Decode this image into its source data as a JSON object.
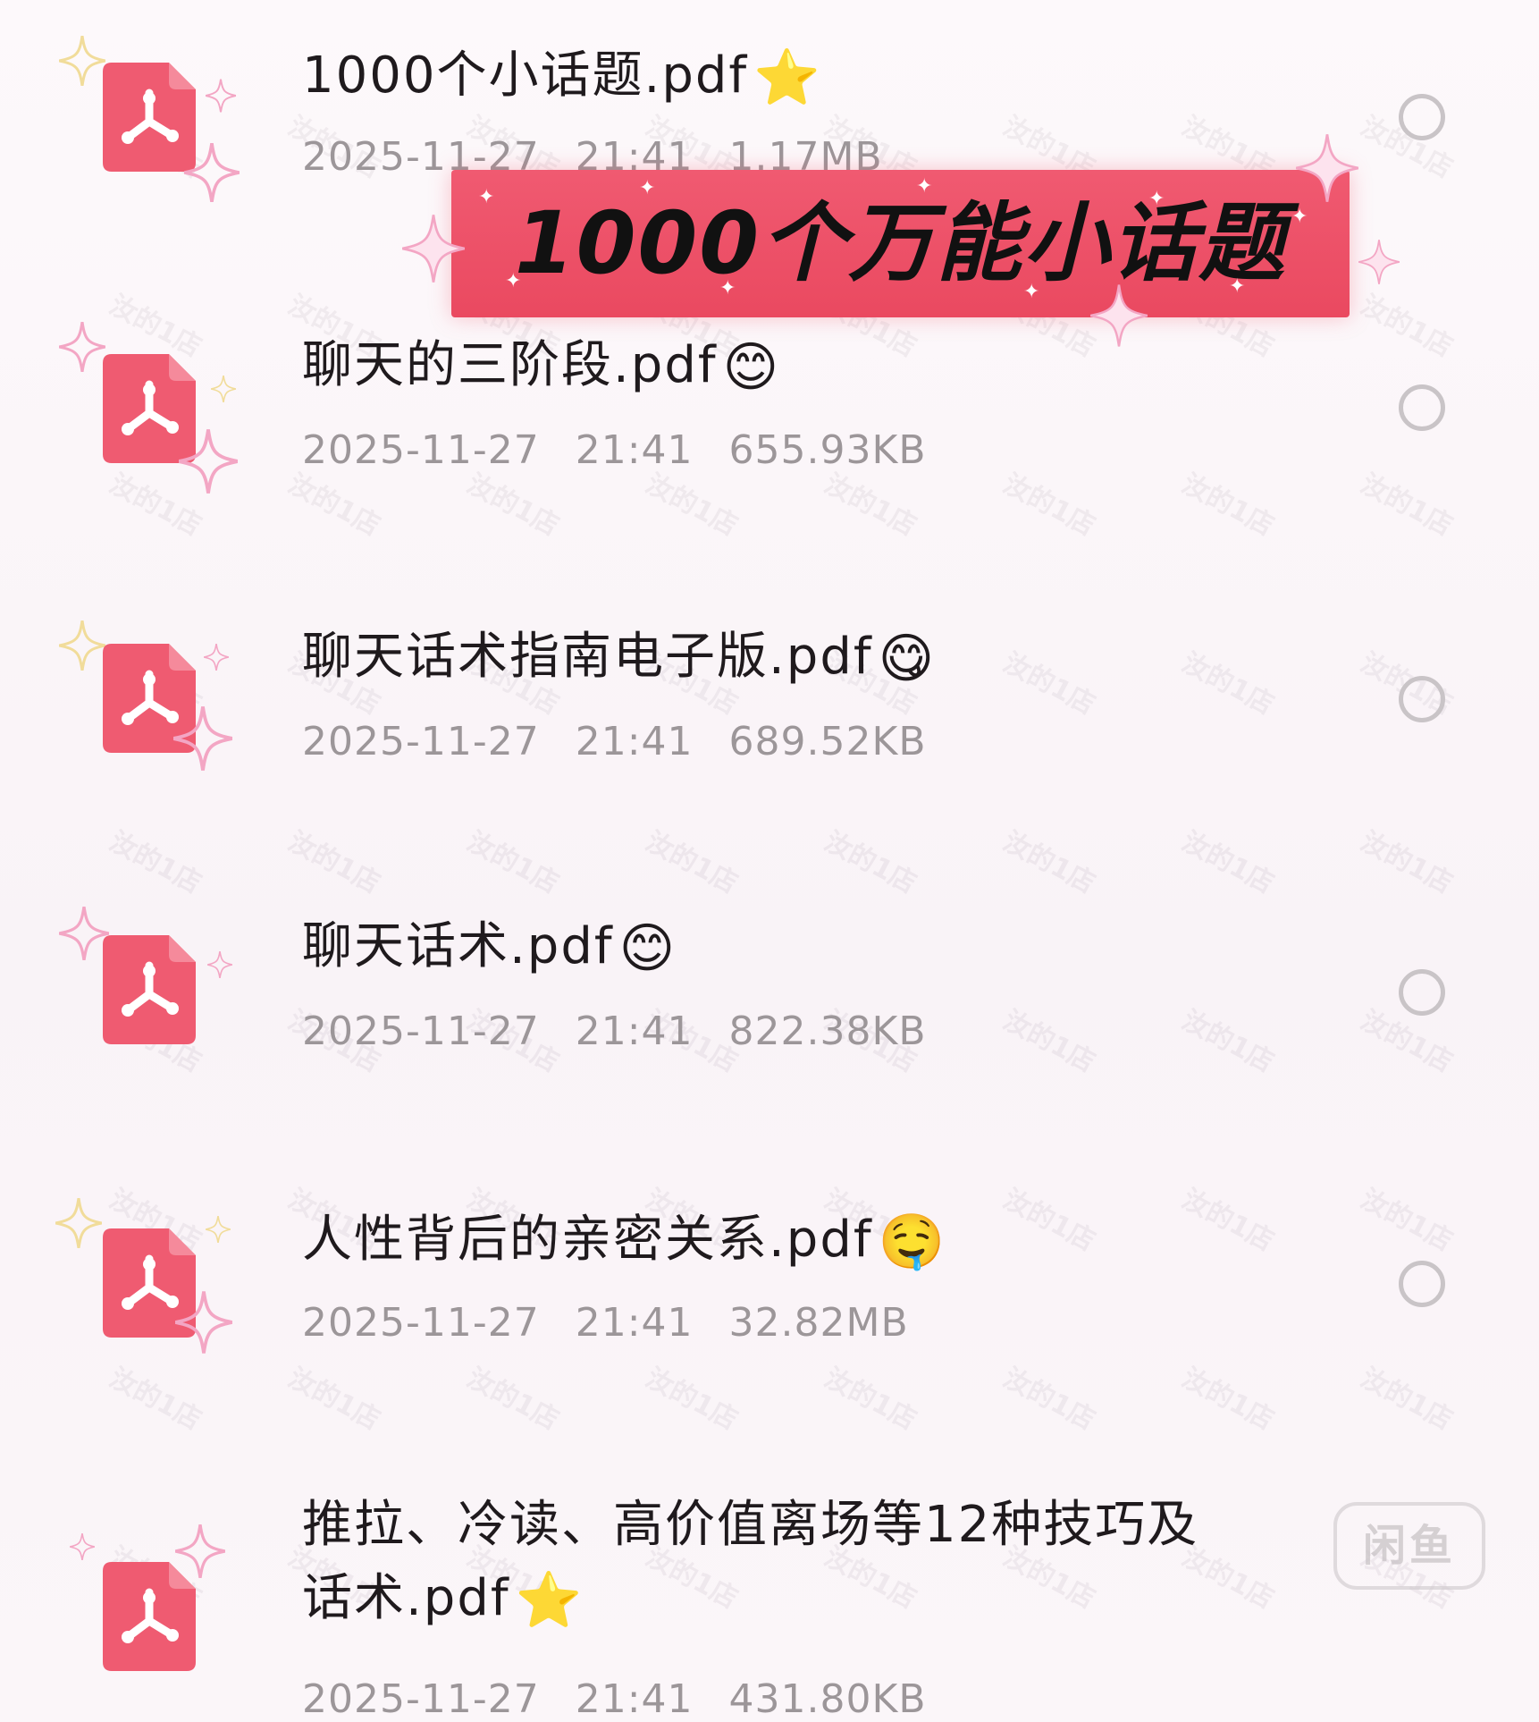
{
  "banner": {
    "title": "1000个万能小话题"
  },
  "files": [
    {
      "name": "1000个小话题.pdf",
      "emoji": "⭐",
      "date": "2025-11-27",
      "time": "21:41",
      "size": "1.17MB"
    },
    {
      "name": "聊天的三阶段.pdf",
      "emoji": "😊",
      "date": "2025-11-27",
      "time": "21:41",
      "size": "655.93KB"
    },
    {
      "name": "聊天话术指南电子版.pdf",
      "emoji": "😋",
      "date": "2025-11-27",
      "time": "21:41",
      "size": "689.52KB"
    },
    {
      "name": "聊天话术.pdf",
      "emoji": "😊",
      "date": "2025-11-27",
      "time": "21:41",
      "size": "822.38KB"
    },
    {
      "name": "人性背后的亲密关系.pdf",
      "emoji": "🤤",
      "date": "2025-11-27",
      "time": "21:41",
      "size": "32.82MB"
    },
    {
      "name": "推拉、冷读、高价值离场等12种技巧及话术.pdf",
      "emoji": "⭐",
      "date": "2025-11-27",
      "time": "21:41",
      "size": "431.80KB"
    }
  ],
  "app_badge": "闲鱼",
  "watermark_text": "汝的1店",
  "colors": {
    "pdf_icon": "#ef5b71",
    "banner": "#ef5068",
    "sparkle_pink": "#f3a6c4",
    "sparkle_yellow": "#f1dc9a",
    "meta_text": "#9c9699",
    "radio": "#c9c4c7"
  },
  "icons": {
    "file": "pdf-file-icon",
    "select": "radio-circle-icon",
    "decoration": "sparkle-icon"
  }
}
